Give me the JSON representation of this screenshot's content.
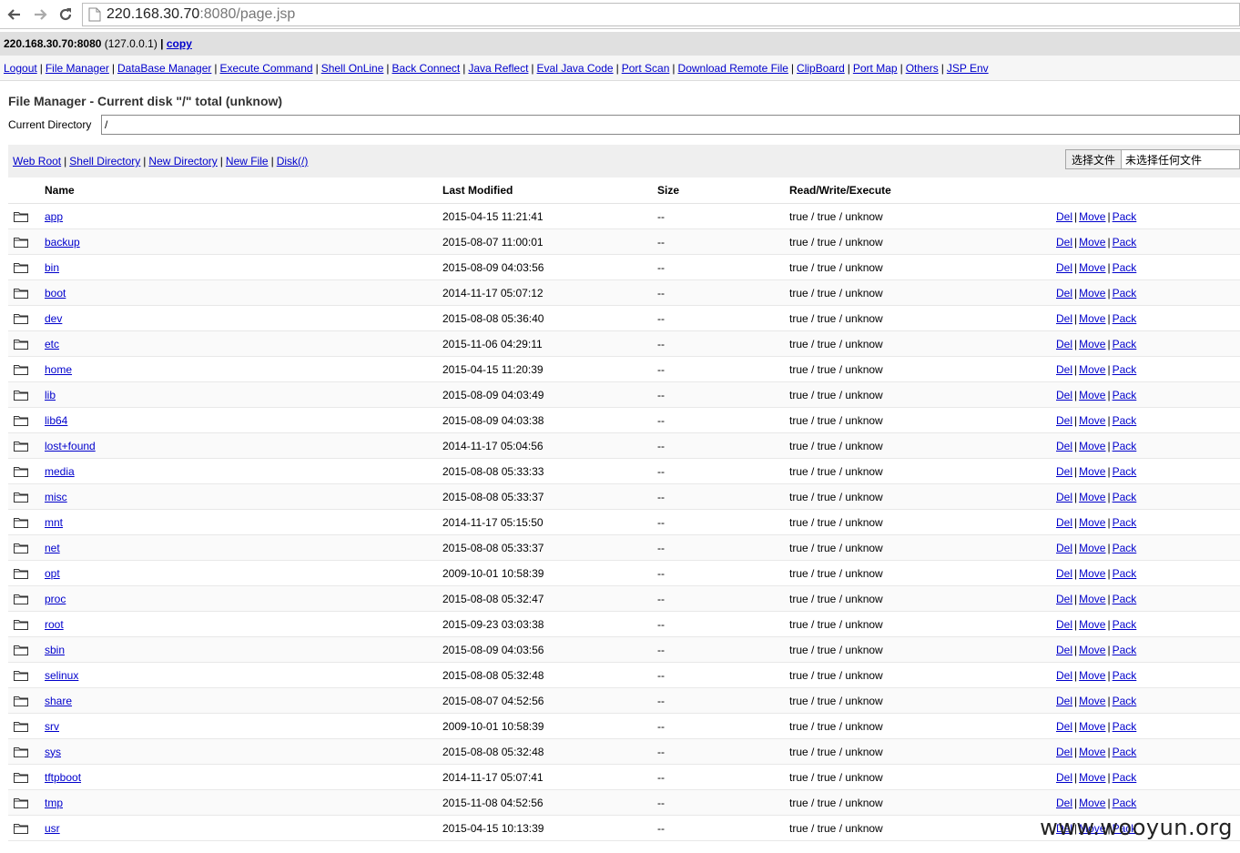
{
  "browser": {
    "url_host": "220.168.30.70",
    "url_rest": ":8080/page.jsp"
  },
  "info": {
    "server": "220.168.30.70:8080",
    "local": "(127.0.0.1)",
    "sep": "|",
    "copy": "copy"
  },
  "menu": [
    "Logout",
    "File Manager",
    "DataBase Manager",
    "Execute Command",
    "Shell OnLine",
    "Back Connect",
    "Java Reflect",
    "Eval Java Code",
    "Port Scan",
    "Download Remote File",
    "ClipBoard",
    "Port Map",
    "Others",
    "JSP Env"
  ],
  "page": {
    "title": "File Manager - Current disk \"/\" total (unknow)",
    "current_dir_label": "Current Directory",
    "current_dir_value": "/"
  },
  "toolbar": {
    "links": [
      "Web Root",
      "Shell Directory",
      "New Directory",
      "New File",
      "Disk(/)"
    ],
    "file_button": "选择文件",
    "file_status": "未选择任何文件"
  },
  "table": {
    "headers": {
      "name": "Name",
      "modified": "Last Modified",
      "size": "Size",
      "rwx": "Read/Write/Execute"
    },
    "actions": [
      "Del",
      "Move",
      "Pack"
    ],
    "rows": [
      {
        "name": "app",
        "modified": "2015-04-15 11:21:41",
        "size": "--",
        "rwx": "true / true / unknow"
      },
      {
        "name": "backup",
        "modified": "2015-08-07 11:00:01",
        "size": "--",
        "rwx": "true / true / unknow"
      },
      {
        "name": "bin",
        "modified": "2015-08-09 04:03:56",
        "size": "--",
        "rwx": "true / true / unknow"
      },
      {
        "name": "boot",
        "modified": "2014-11-17 05:07:12",
        "size": "--",
        "rwx": "true / true / unknow"
      },
      {
        "name": "dev",
        "modified": "2015-08-08 05:36:40",
        "size": "--",
        "rwx": "true / true / unknow"
      },
      {
        "name": "etc",
        "modified": "2015-11-06 04:29:11",
        "size": "--",
        "rwx": "true / true / unknow"
      },
      {
        "name": "home",
        "modified": "2015-04-15 11:20:39",
        "size": "--",
        "rwx": "true / true / unknow"
      },
      {
        "name": "lib",
        "modified": "2015-08-09 04:03:49",
        "size": "--",
        "rwx": "true / true / unknow"
      },
      {
        "name": "lib64",
        "modified": "2015-08-09 04:03:38",
        "size": "--",
        "rwx": "true / true / unknow"
      },
      {
        "name": "lost+found",
        "modified": "2014-11-17 05:04:56",
        "size": "--",
        "rwx": "true / true / unknow"
      },
      {
        "name": "media",
        "modified": "2015-08-08 05:33:33",
        "size": "--",
        "rwx": "true / true / unknow"
      },
      {
        "name": "misc",
        "modified": "2015-08-08 05:33:37",
        "size": "--",
        "rwx": "true / true / unknow"
      },
      {
        "name": "mnt",
        "modified": "2014-11-17 05:15:50",
        "size": "--",
        "rwx": "true / true / unknow"
      },
      {
        "name": "net",
        "modified": "2015-08-08 05:33:37",
        "size": "--",
        "rwx": "true / true / unknow"
      },
      {
        "name": "opt",
        "modified": "2009-10-01 10:58:39",
        "size": "--",
        "rwx": "true / true / unknow"
      },
      {
        "name": "proc",
        "modified": "2015-08-08 05:32:47",
        "size": "--",
        "rwx": "true / true / unknow"
      },
      {
        "name": "root",
        "modified": "2015-09-23 03:03:38",
        "size": "--",
        "rwx": "true / true / unknow"
      },
      {
        "name": "sbin",
        "modified": "2015-08-09 04:03:56",
        "size": "--",
        "rwx": "true / true / unknow"
      },
      {
        "name": "selinux",
        "modified": "2015-08-08 05:32:48",
        "size": "--",
        "rwx": "true / true / unknow"
      },
      {
        "name": "share",
        "modified": "2015-08-07 04:52:56",
        "size": "--",
        "rwx": "true / true / unknow"
      },
      {
        "name": "srv",
        "modified": "2009-10-01 10:58:39",
        "size": "--",
        "rwx": "true / true / unknow"
      },
      {
        "name": "sys",
        "modified": "2015-08-08 05:32:48",
        "size": "--",
        "rwx": "true / true / unknow"
      },
      {
        "name": "tftpboot",
        "modified": "2014-11-17 05:07:41",
        "size": "--",
        "rwx": "true / true / unknow"
      },
      {
        "name": "tmp",
        "modified": "2015-11-08 04:52:56",
        "size": "--",
        "rwx": "true / true / unknow"
      },
      {
        "name": "usr",
        "modified": "2015-04-15 10:13:39",
        "size": "--",
        "rwx": "true / true / unknow"
      }
    ]
  },
  "watermark": "www.wooyun.org"
}
